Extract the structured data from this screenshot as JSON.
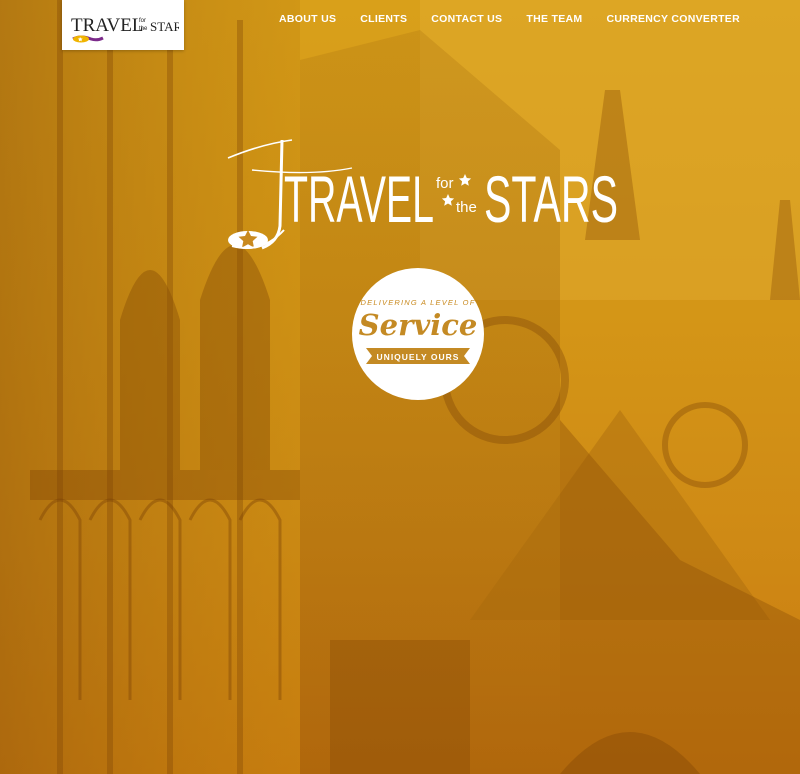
{
  "colors": {
    "overlay_top": "#d9a01a",
    "overlay_bottom": "#c9780f",
    "badge_gold": "#c48a24",
    "nav_text": "#ffffff"
  },
  "logo": {
    "name": "Travel for the Stars"
  },
  "nav": {
    "items": [
      "ABOUT US",
      "CLIENTS",
      "CONTACT US",
      "THE TEAM",
      "CURRENCY CONVERTER"
    ]
  },
  "hero": {
    "title_main": "TRAVEL",
    "title_small_1": "for",
    "title_small_2": "the",
    "title_end": "STARS",
    "badge": {
      "line1": "DELIVERING A LEVEL OF",
      "word": "Service",
      "ribbon": "UNIQUELY OURS"
    }
  }
}
